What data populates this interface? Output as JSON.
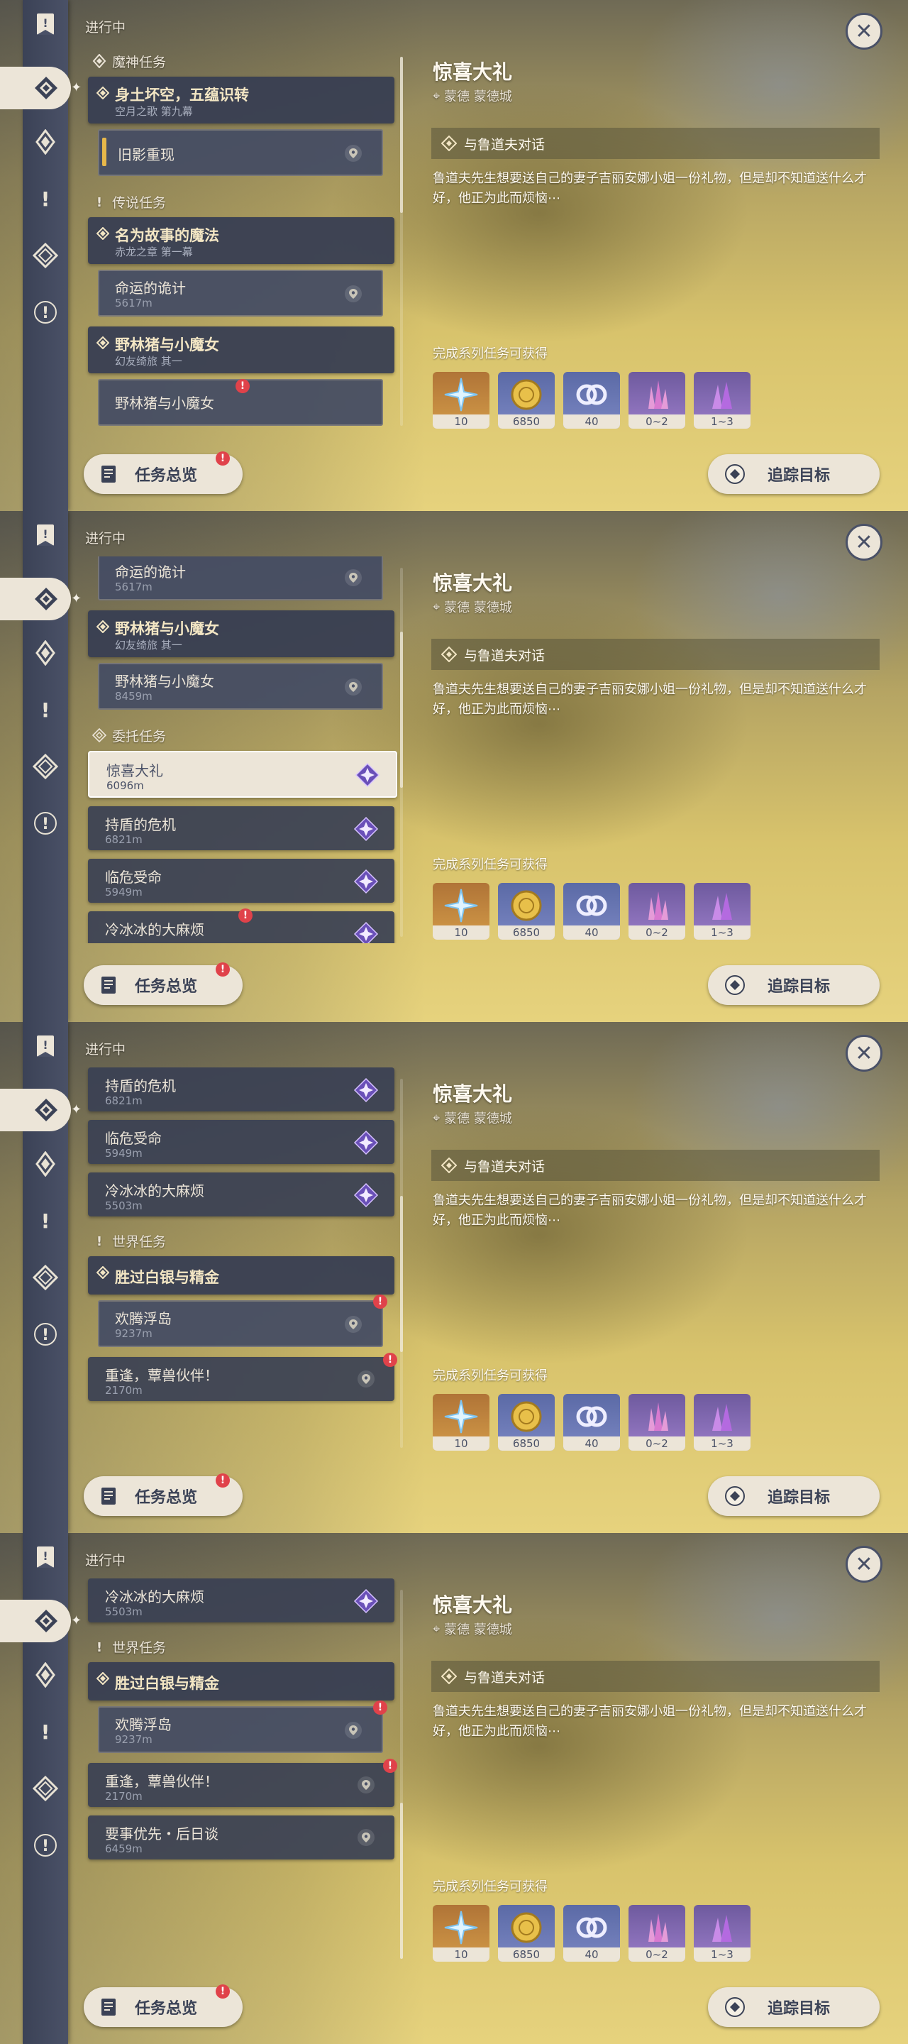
{
  "status_label": "进行中",
  "quest_detail": {
    "title": "惊喜大礼",
    "location": "蒙德 蒙德城",
    "step": "与鲁道夫对话",
    "description": "鲁道夫先生想要送自己的妻子吉丽安娜小姐一份礼物，但是却不知道送什么才好，他正为此而烦恼⋯",
    "reward_label": "完成系列任务可获得",
    "rewards": [
      {
        "icon": "primogem-icon",
        "amount": "10",
        "color": "#c8873d"
      },
      {
        "icon": "mora-icon",
        "amount": "6850",
        "color": "#6371b0"
      },
      {
        "icon": "companionship-exp-icon",
        "amount": "40",
        "color": "#6371b0"
      },
      {
        "icon": "crystal-cluster-icon",
        "amount": "0~2",
        "color": "#8a6cc0"
      },
      {
        "icon": "crystal-chunk-icon",
        "amount": "1~3",
        "color": "#8a6cc0"
      }
    ]
  },
  "buttons": {
    "overview": "任务总览",
    "track": "追踪目标"
  },
  "panels": [
    {
      "scroll_position": 0.0,
      "items": [
        {
          "kind": "category",
          "icon": "archon-quest-icon",
          "label": "魔神任务"
        },
        {
          "kind": "quest",
          "title": "身土坏空，五蕴识转",
          "subtitle": "空月之歌 第九幕",
          "main": true
        },
        {
          "kind": "sub",
          "title": "旧影重现",
          "distance": "",
          "gold": true
        },
        {
          "kind": "category",
          "icon": "legend-quest-icon",
          "label": "传说任务"
        },
        {
          "kind": "quest",
          "title": "名为故事的魔法",
          "subtitle": "赤龙之章 第一幕",
          "main": true
        },
        {
          "kind": "sub",
          "title": "命运的诡计",
          "distance": "5617m"
        },
        {
          "kind": "quest",
          "title": "野林猪与小魔女",
          "subtitle": "幻友绮旅 其一",
          "main": true
        },
        {
          "kind": "sub",
          "title": "野林猪与小魔女",
          "distance": "",
          "alert": true
        }
      ]
    },
    {
      "scroll_position": 0.3,
      "items": [
        {
          "kind": "sub",
          "title": "命运的诡计",
          "distance": "5617m"
        },
        {
          "kind": "quest",
          "title": "野林猪与小魔女",
          "subtitle": "幻友绮旅 其一",
          "main": true
        },
        {
          "kind": "sub",
          "title": "野林猪与小魔女",
          "distance": "8459m"
        },
        {
          "kind": "category",
          "icon": "commission-quest-icon",
          "label": "委托任务"
        },
        {
          "kind": "plain",
          "title": "惊喜大礼",
          "distance": "6096m",
          "selected": true,
          "violet": true
        },
        {
          "kind": "plain",
          "title": "持盾的危机",
          "distance": "6821m",
          "violet": true
        },
        {
          "kind": "plain",
          "title": "临危受命",
          "distance": "5949m",
          "violet": true
        },
        {
          "kind": "plain",
          "title": "冷冰冰的大麻烦",
          "distance": "",
          "violet": true,
          "alert": true
        }
      ]
    },
    {
      "scroll_position": 0.55,
      "items": [
        {
          "kind": "plain",
          "title": "持盾的危机",
          "distance": "6821m",
          "violet": true
        },
        {
          "kind": "plain",
          "title": "临危受命",
          "distance": "5949m",
          "violet": true
        },
        {
          "kind": "plain",
          "title": "冷冰冰的大麻烦",
          "distance": "5503m",
          "violet": true
        },
        {
          "kind": "category",
          "icon": "world-quest-icon",
          "label": "世界任务"
        },
        {
          "kind": "quest",
          "title": "胜过白银与精金",
          "subtitle": "",
          "main": true
        },
        {
          "kind": "sub",
          "title": "欢腾浮岛",
          "distance": "9237m",
          "alert": true
        },
        {
          "kind": "plain",
          "title": "重逢，蕈兽伙伴！",
          "distance": "2170m",
          "pin": true,
          "alert": true
        }
      ]
    },
    {
      "scroll_position": 1.0,
      "items": [
        {
          "kind": "plain",
          "title": "冷冰冰的大麻烦",
          "distance": "5503m",
          "violet": true
        },
        {
          "kind": "category",
          "icon": "world-quest-icon",
          "label": "世界任务"
        },
        {
          "kind": "quest",
          "title": "胜过白银与精金",
          "subtitle": "",
          "main": true
        },
        {
          "kind": "sub",
          "title": "欢腾浮岛",
          "distance": "9237m",
          "alert": true
        },
        {
          "kind": "plain",
          "title": "重逢，蕈兽伙伴！",
          "distance": "2170m",
          "pin": true,
          "alert": true
        },
        {
          "kind": "plain",
          "title": "要事优先・后日谈",
          "distance": "6459m",
          "pin": true
        }
      ]
    }
  ]
}
